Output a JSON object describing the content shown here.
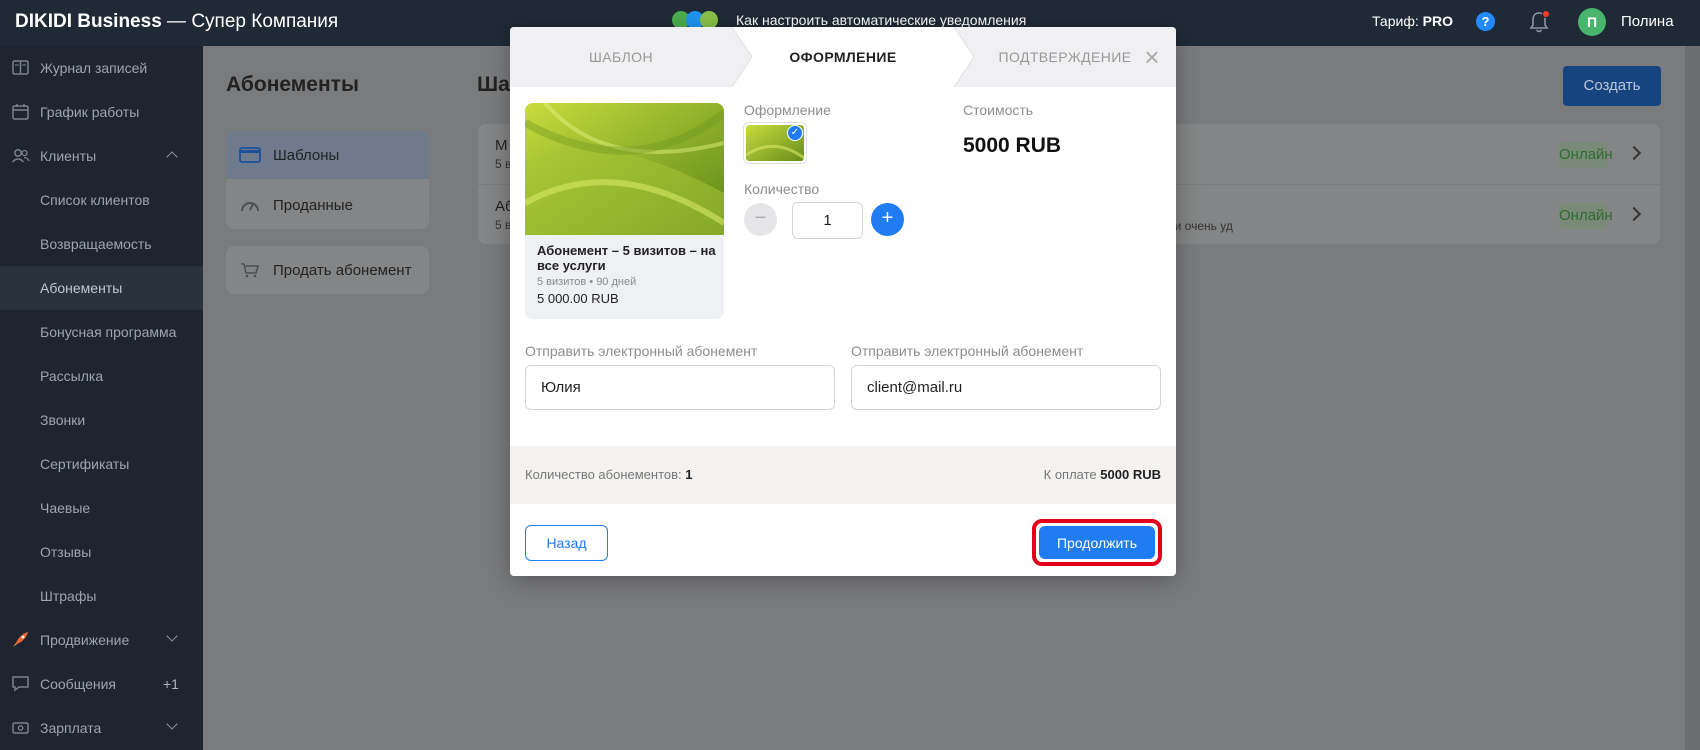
{
  "topbar": {
    "brand": "DIKIDI Business",
    "company": "—  Супер Компания",
    "promo_text": "Как настроить автоматические уведомления",
    "tarif_label": "Тариф:",
    "tarif_value": "PRO",
    "help_icon": "?",
    "avatar_letter": "П",
    "user_name": "Полина"
  },
  "sidebar": {
    "items": [
      {
        "label": "Журнал записей",
        "icon": "journal-icon"
      },
      {
        "label": "График работы",
        "icon": "calendar-icon"
      },
      {
        "label": "Клиенты",
        "icon": "clients-icon",
        "expanded": true
      },
      {
        "label": "Список клиентов"
      },
      {
        "label": "Возвращаемость"
      },
      {
        "label": "Абонементы",
        "active": true
      },
      {
        "label": "Бонусная программа"
      },
      {
        "label": "Рассылка"
      },
      {
        "label": "Звонки"
      },
      {
        "label": "Сертификаты"
      },
      {
        "label": "Чаевые"
      },
      {
        "label": "Отзывы"
      },
      {
        "label": "Штрафы"
      },
      {
        "label": "Продвижение",
        "icon": "rocket-icon"
      },
      {
        "label": "Сообщения",
        "icon": "chat-icon",
        "badge": "+1"
      },
      {
        "label": "Зарплата",
        "icon": "salary-icon"
      }
    ]
  },
  "page": {
    "title": "Абонементы",
    "title_right": "Ша",
    "create_label": "Создать",
    "nav": {
      "templates": "Шаблоны",
      "sold": "Проданные",
      "sell": "Продать абонемент"
    },
    "list": [
      {
        "name": "М",
        "sub": "5 в",
        "status": "Онлайн",
        "desc": ""
      },
      {
        "name": "Аб",
        "sub": "5 в",
        "status": "Онлайн",
        "desc": "но и очень уд"
      }
    ]
  },
  "modal": {
    "steps": [
      "ШАБЛОН",
      "ОФОРМЛЕНИЕ",
      "ПОДТВЕРЖДЕНИЕ"
    ],
    "active_step": 1,
    "close_icon": "×",
    "preview": {
      "name": "Абонемент – 5 визитов – на все услуги",
      "meta": "5 визитов • 90 дней",
      "price": "5 000.00 RUB"
    },
    "design_label": "Оформление",
    "price_label": "Стоимость",
    "price_value": "5000 RUB",
    "quantity_label": "Количество",
    "quantity_value": "1",
    "minus_glyph": "−",
    "plus_glyph": "+",
    "send_label_1": "Отправить электронный абонемент",
    "send_label_2": "Отправить электронный абонемент",
    "name_value": "Юлия",
    "email_value": "client@mail.ru",
    "summary_count_label": "Количество абонементов:",
    "summary_count_value": "1",
    "summary_total_label": "К оплате",
    "summary_total_value": "5000 RUB",
    "back_label": "Назад",
    "continue_label": "Продолжить"
  },
  "colors": {
    "topbar": "#1f2a36",
    "sidebar": "#1e2530",
    "accent": "#1f7cf2",
    "highlight": "#e3001b",
    "online": "#2e6b2f"
  }
}
